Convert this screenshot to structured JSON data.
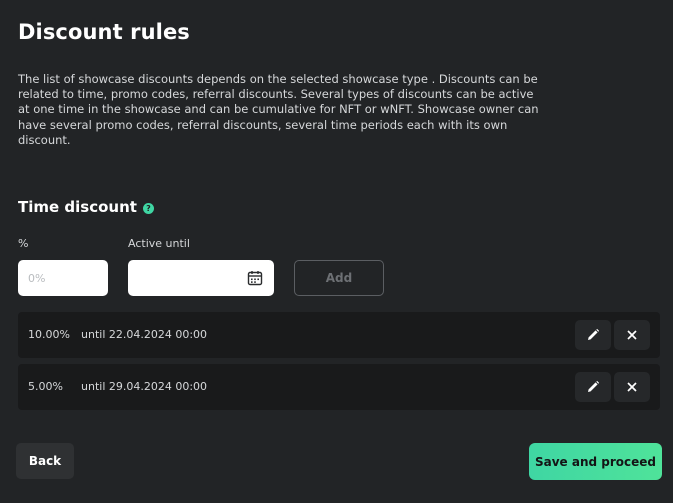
{
  "page": {
    "title": "Discount rules",
    "description": "The list of showcase discounts depends on the selected showcase type . Discounts can be related to time, promo codes, referral discounts. Several types of discounts can be active at one time in the showcase and can be cumulative for NFT or wNFT. Showcase owner can have several promo codes, referral discounts, several time periods each with its own discount."
  },
  "time_discount": {
    "title": "Time discount",
    "help_icon": "question-icon",
    "percent_label": "%",
    "percent_value": "",
    "percent_placeholder": "0%",
    "active_until_label": "Active until",
    "active_until_value": "",
    "add_label": "Add",
    "rules": [
      {
        "percent": "10.00%",
        "until": "until 22.04.2024 00:00"
      },
      {
        "percent": "5.00%",
        "until": "until 29.04.2024 00:00"
      }
    ]
  },
  "footer": {
    "back_label": "Back",
    "save_label": "Save and proceed"
  },
  "colors": {
    "accent": "#3fd6a3",
    "background": "#222426",
    "row_background": "#191a1b"
  }
}
